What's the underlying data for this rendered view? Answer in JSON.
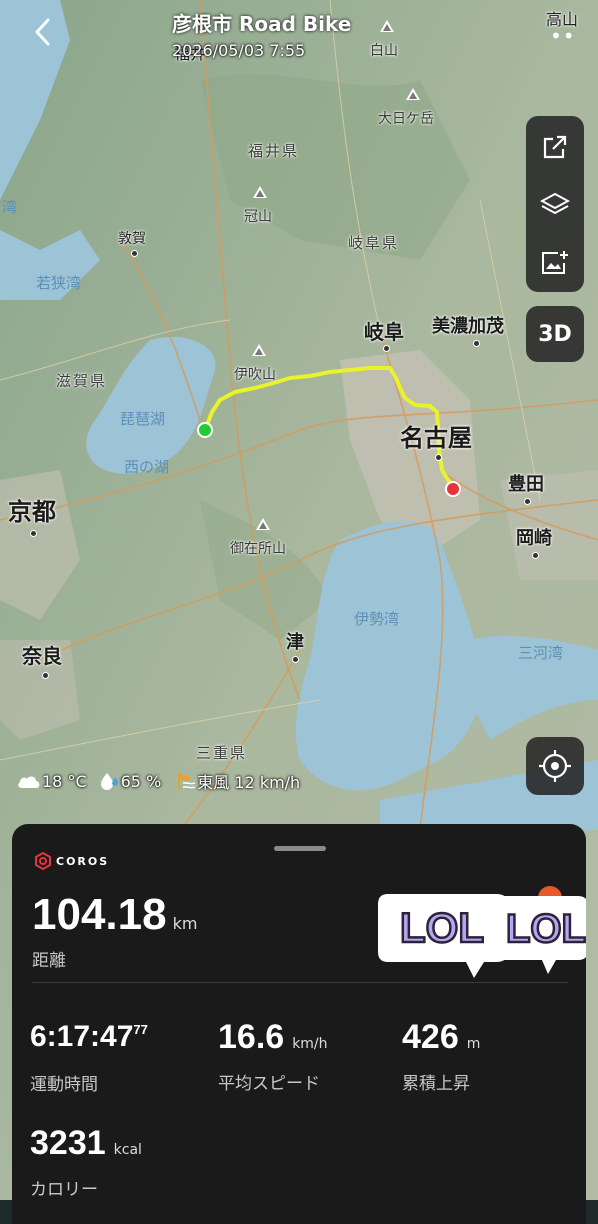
{
  "header": {
    "title": "彦根市 Road Bike",
    "datetime": "2026/05/03 7:55",
    "more_icon": "more-dots-icon",
    "sport_icon": "bike-icon"
  },
  "map": {
    "cities": [
      {
        "name": "京都",
        "size": 24
      },
      {
        "name": "奈良",
        "size": 20
      },
      {
        "name": "名古屋",
        "size": 24
      },
      {
        "name": "岐阜",
        "size": 20
      },
      {
        "name": "美濃加茂",
        "size": 18
      },
      {
        "name": "豊田",
        "size": 18
      },
      {
        "name": "岡崎",
        "size": 18
      },
      {
        "name": "津",
        "size": 18
      },
      {
        "name": "敦賀",
        "size": 14
      },
      {
        "name": "福井",
        "size": 16
      },
      {
        "name": "高山",
        "size": 16
      }
    ],
    "prefectures": [
      "福井県",
      "岐阜県",
      "滋賀県",
      "三重県"
    ],
    "mountains": [
      "白山",
      "大日ケ岳",
      "冠山",
      "伊吹山",
      "御在所山"
    ],
    "water": [
      "琵琶湖",
      "伊勢湾",
      "三河湾",
      "若狭湾",
      "西の湖",
      "湾"
    ]
  },
  "controls": {
    "share_icon": "share-icon",
    "layers_icon": "layers-icon",
    "image_icon": "add-image-icon",
    "three_d_label": "3D",
    "locate_icon": "locate-icon"
  },
  "weather": {
    "temperature": "18 °C",
    "humidity": "65 %",
    "wind": "東風 12 km/h"
  },
  "summary": {
    "brand": "COROS",
    "distance": {
      "value": "104.18",
      "unit": "km",
      "label": "距離"
    },
    "duration": {
      "value": "6:17:47",
      "fraction": "77",
      "label": "運動時間"
    },
    "avg_speed": {
      "value": "16.6",
      "unit": "km/h",
      "label": "平均スピード"
    },
    "elevation": {
      "value": "426",
      "unit": "m",
      "label": "累積上昇"
    },
    "calories": {
      "value": "3231",
      "unit": "kcal",
      "label": "カロリー"
    },
    "sticker_text": "LOL"
  },
  "colors": {
    "route": "#eaf22a",
    "start": "#22cc33",
    "end": "#e8323c",
    "panel": "#1a1a1a",
    "sport_green": "#2ecc40",
    "sticker_purple": "#b9a4f2"
  }
}
